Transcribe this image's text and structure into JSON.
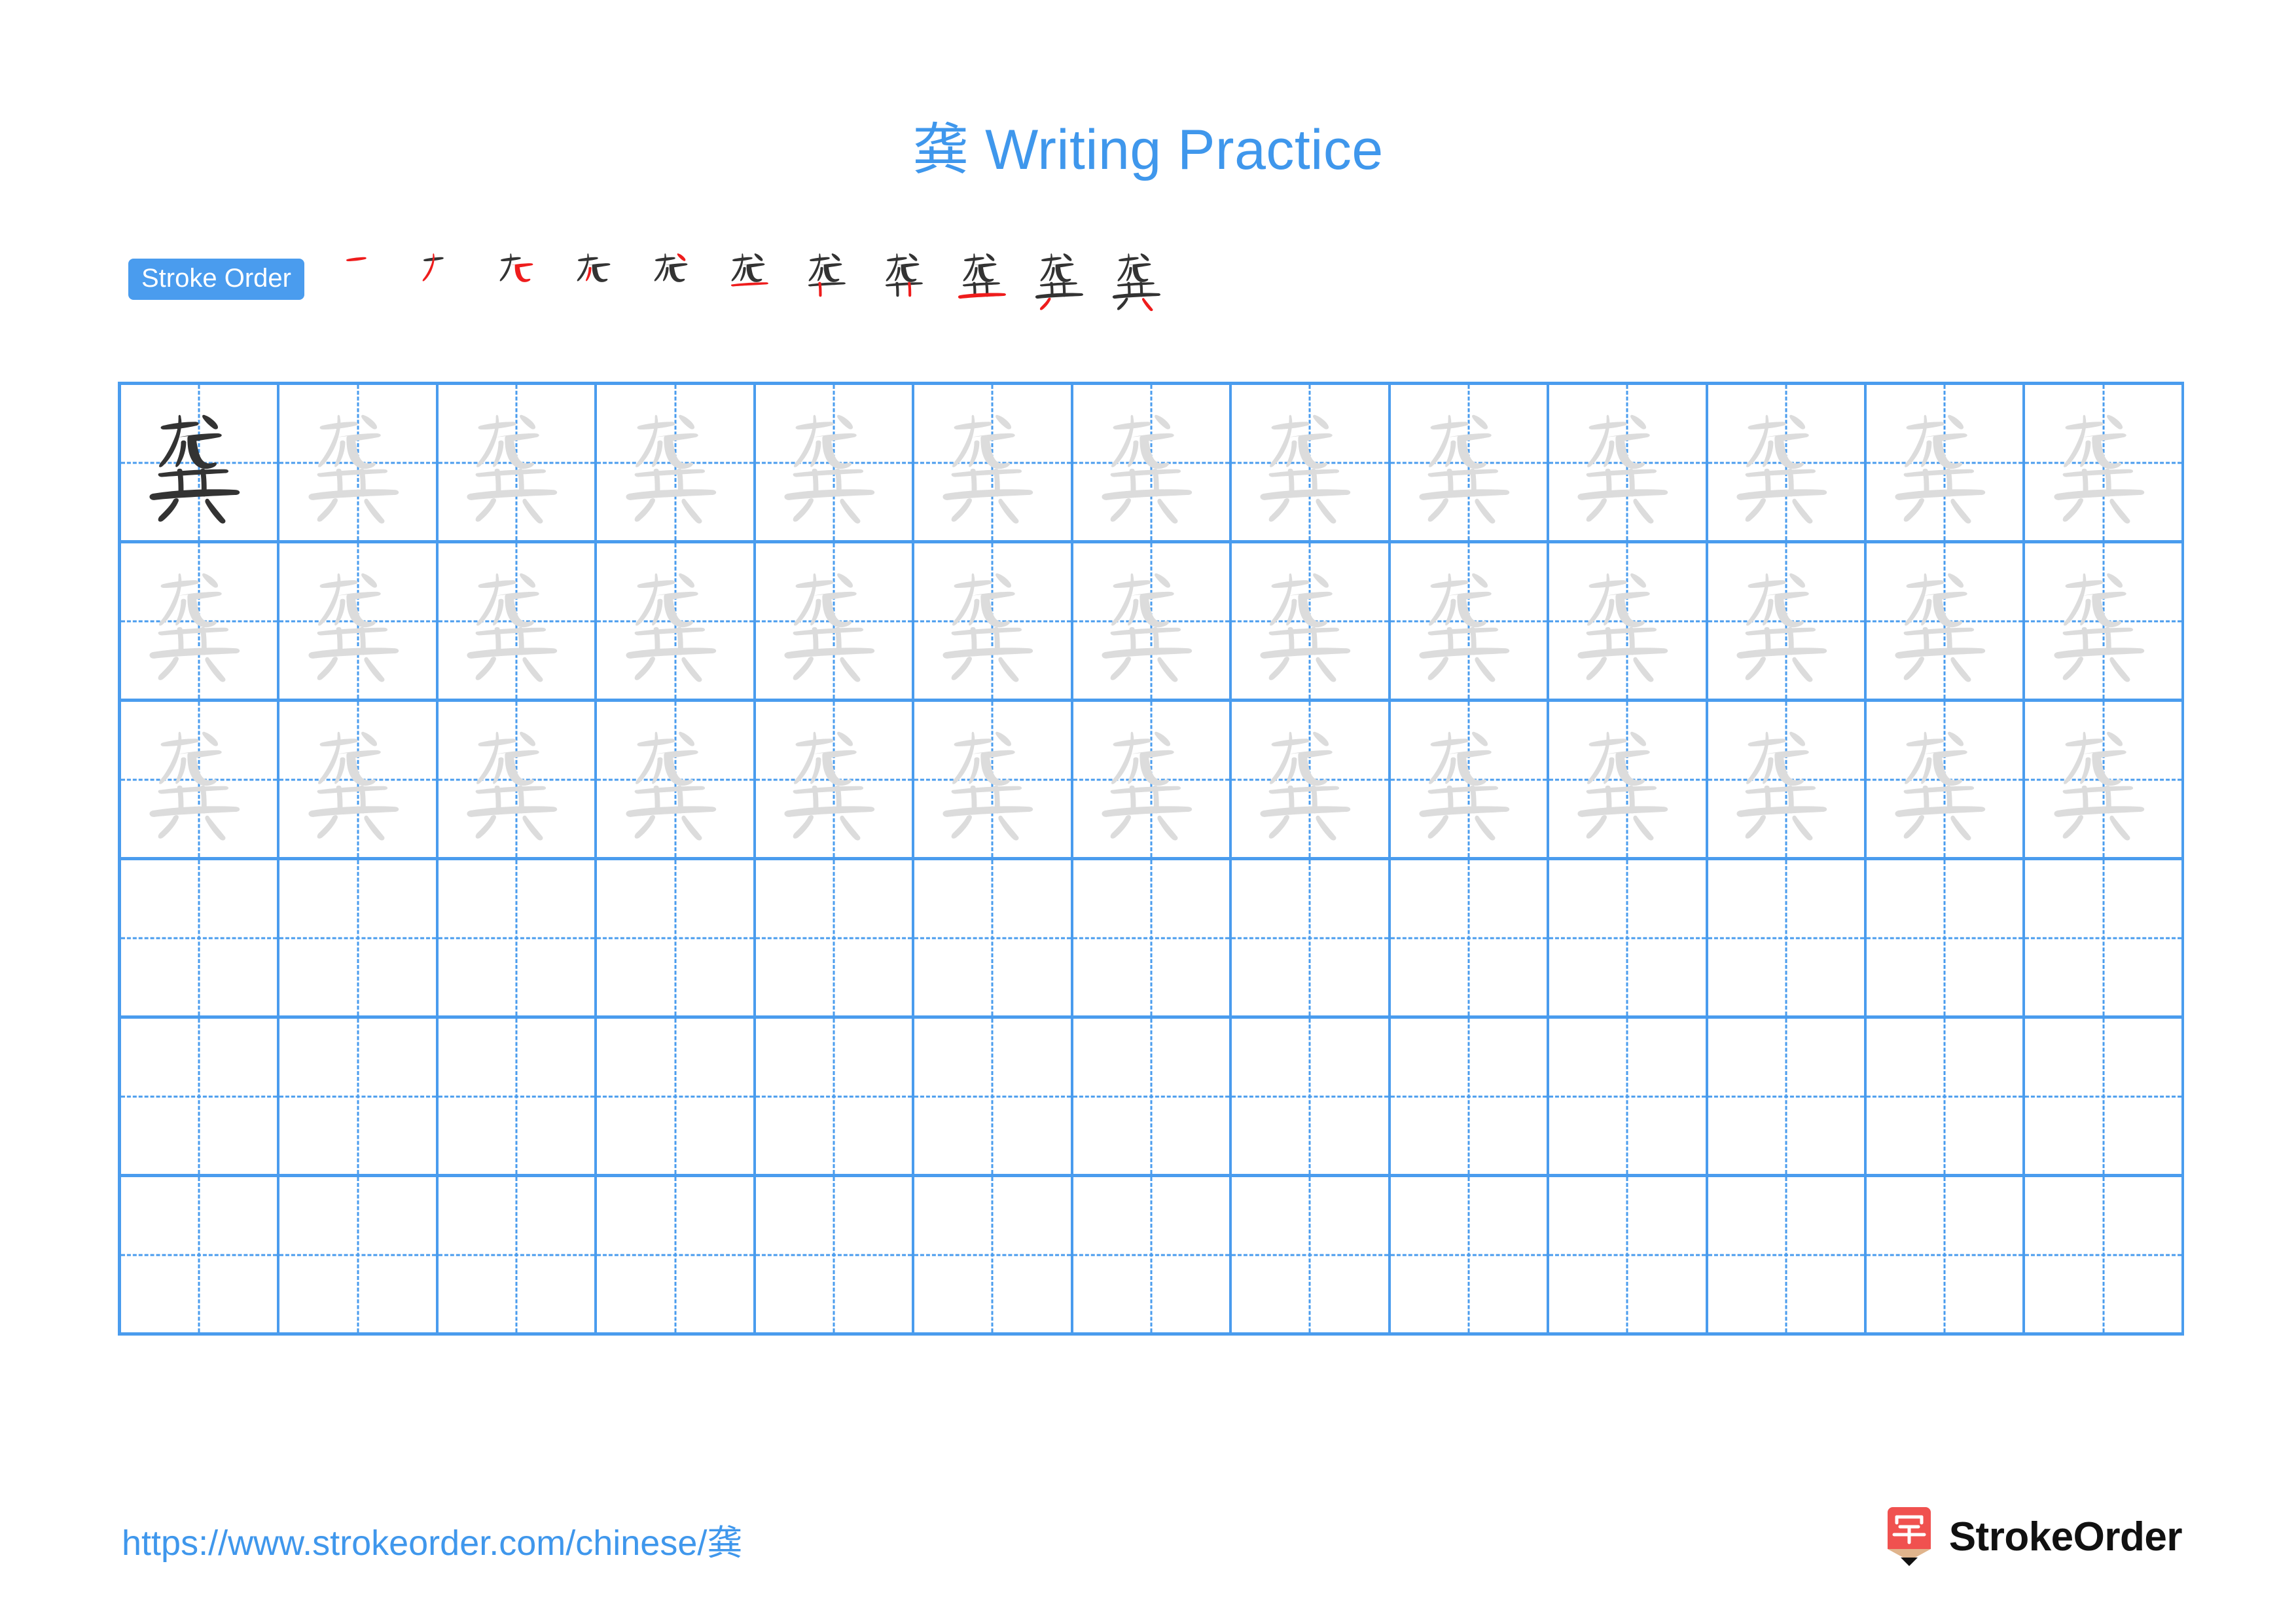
{
  "page": {
    "character": "龚",
    "title_suffix": " Writing Practice",
    "title_full": "龚 Writing Practice"
  },
  "colors": {
    "accent_blue": "#4A9CEE",
    "title_blue": "#3F97EC",
    "grid_line": "#4A9CEE",
    "trace_gray": "#DCDCDC",
    "model_dark": "#333333",
    "new_stroke_red": "#EE1C1C",
    "logo_red": "#F0514F",
    "logo_tip": "#E0B48C",
    "logo_text": "#111111"
  },
  "stroke_order": {
    "badge_label": "Stroke Order",
    "total_strokes": 11,
    "steps": [
      {
        "index": 1,
        "new_stroke": "横 (heng)",
        "cumulative": "一"
      },
      {
        "index": 2,
        "new_stroke": "撇 (pie)",
        "cumulative": "ナ"
      },
      {
        "index": 3,
        "new_stroke": "横折弯钩 (hengzhewangou)",
        "cumulative": "九"
      },
      {
        "index": 4,
        "new_stroke": "撇 (pie)",
        "cumulative": "九"
      },
      {
        "index": 5,
        "new_stroke": "点 (dian)",
        "cumulative": "龙"
      },
      {
        "index": 6,
        "new_stroke": "横 (heng)",
        "cumulative": "龙"
      },
      {
        "index": 7,
        "new_stroke": "竖 (shu)",
        "cumulative": "龚"
      },
      {
        "index": 8,
        "new_stroke": "竖 (shu)",
        "cumulative": "龚"
      },
      {
        "index": 9,
        "new_stroke": "横 (heng)",
        "cumulative": "龚"
      },
      {
        "index": 10,
        "new_stroke": "撇 (pie)",
        "cumulative": "龚"
      },
      {
        "index": 11,
        "new_stroke": "点 (dian)",
        "cumulative": "龚"
      }
    ]
  },
  "practice_grid": {
    "columns": 13,
    "rows": 6,
    "filled_rows": 3,
    "empty_rows": 3,
    "model_cell": {
      "row": 1,
      "column": 1,
      "style": "dark"
    },
    "trace_style": "light-gray",
    "guide_lines": "dashed-cross"
  },
  "footer": {
    "url": "https://www.strokeorder.com/chinese/龚",
    "brand_name": "StrokeOrder",
    "logo_char": "字",
    "logo_icon": "pencil-icon"
  }
}
